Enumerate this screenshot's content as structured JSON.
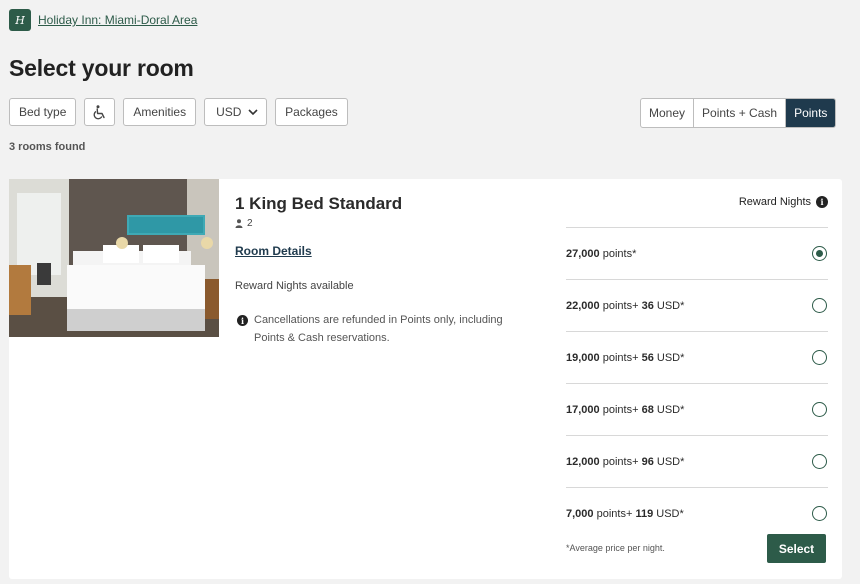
{
  "header": {
    "logo_glyph": "H",
    "hotel_name": "Holiday Inn: Miami-Doral Area"
  },
  "page": {
    "title": "Select your room"
  },
  "filters": {
    "bed_type": "Bed type",
    "accessibility_icon": "wheelchair-icon",
    "amenities": "Amenities",
    "currency": "USD",
    "packages": "Packages"
  },
  "rate_toggle": {
    "options": [
      "Money",
      "Points + Cash",
      "Points"
    ],
    "active": "Points"
  },
  "results": {
    "count_text": "3 rooms found"
  },
  "room": {
    "title": "1 King Bed Standard",
    "occupancy": "2",
    "details_link": "Room Details",
    "availability": "Reward Nights available",
    "cancellation_note": "Cancellations are refunded in Points only, including Points & Cash reservations.",
    "reward_header": "Reward Nights",
    "rates": [
      {
        "points": "27,000",
        "points_label": "points*",
        "plus": "",
        "cash": "",
        "currency": "",
        "selected": true
      },
      {
        "points": "22,000",
        "points_label": "points",
        "plus": "+",
        "cash": "36",
        "currency": "USD*",
        "selected": false
      },
      {
        "points": "19,000",
        "points_label": "points",
        "plus": "+",
        "cash": "56",
        "currency": "USD*",
        "selected": false
      },
      {
        "points": "17,000",
        "points_label": "points",
        "plus": "+",
        "cash": "68",
        "currency": "USD*",
        "selected": false
      },
      {
        "points": "12,000",
        "points_label": "points",
        "plus": "+",
        "cash": "96",
        "currency": "USD*",
        "selected": false
      },
      {
        "points": "7,000",
        "points_label": "points",
        "plus": "+",
        "cash": "119",
        "currency": "USD*",
        "selected": false
      }
    ],
    "footnote": "*Average price per night.",
    "select_label": "Select"
  },
  "colors": {
    "brand_green": "#2d5b49",
    "toggle_active": "#1f3a4d",
    "background": "#f2f2f2"
  }
}
